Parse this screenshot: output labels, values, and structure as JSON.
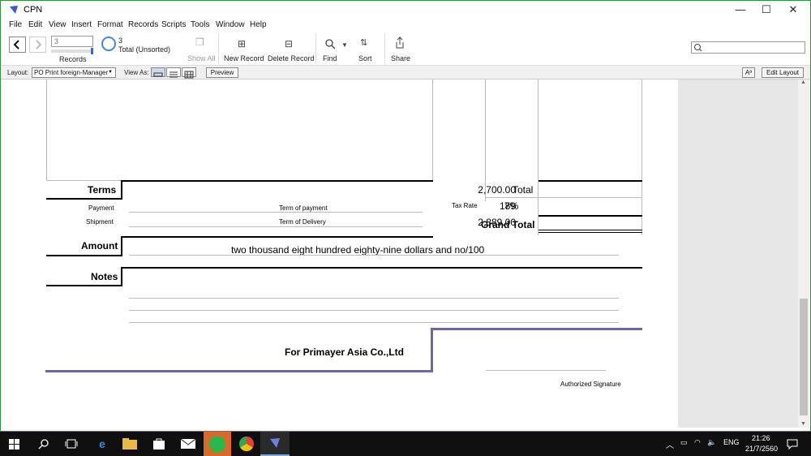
{
  "window": {
    "title": "CPN",
    "minimize": "—",
    "maximize": "☐",
    "close": "✕"
  },
  "menu": [
    "File",
    "Edit",
    "View",
    "Insert",
    "Format",
    "Records",
    "Scripts",
    "Tools",
    "Window",
    "Help"
  ],
  "toolbar": {
    "record_number": "3",
    "records_label": "Records",
    "total_count": "3",
    "total_label": "Total (Unsorted)",
    "show_all": "Show All",
    "new_record": "New Record",
    "delete_record": "Delete Record",
    "find": "Find",
    "sort": "Sort",
    "share": "Share"
  },
  "layoutbar": {
    "layout_label": "Layout:",
    "layout_value": "PO Print foreign-Manager",
    "view_as_label": "View As:",
    "preview": "Preview",
    "aa": "Aª",
    "edit_layout": "Edit Layout"
  },
  "document": {
    "terms_label": "Terms",
    "payment_label": "Payment",
    "payment_value": "Term of payment",
    "shipment_label": "Shipment",
    "shipment_value": "Term of Delivery",
    "total_label": "Total",
    "total_value": "2,700.00",
    "tax_rate_label": "Tax Rate",
    "tax_rate_value": "7%",
    "tax_amount": "189",
    "grand_total_label": "Grand Total",
    "grand_total_value": "2,889.00",
    "amount_label": "Amount",
    "amount_words": "two thousand eight hundred eighty-nine dollars and no/100",
    "notes_label": "Notes",
    "for_company": "For  Primayer Asia Co.,Ltd",
    "authorized_signature": "Authorized Signature"
  },
  "taskbar": {
    "time": "21:26",
    "date": "21/7/2560",
    "language": "ENG"
  },
  "colors": {
    "accent_line": "#6b6aa0",
    "taskbar": "#101010"
  }
}
